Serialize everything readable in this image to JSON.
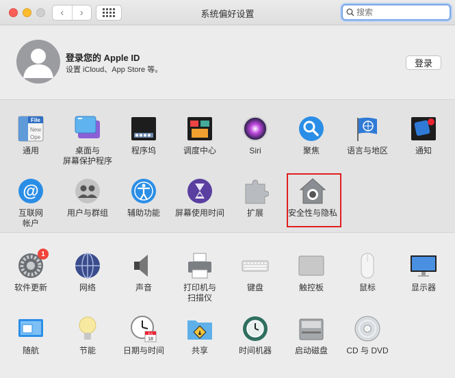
{
  "window": {
    "title": "系统偏好设置"
  },
  "search": {
    "placeholder": "搜索"
  },
  "account": {
    "title": "登录您的 Apple ID",
    "subtitle": "设置 iCloud、App Store 等。",
    "login_label": "登录"
  },
  "prefs_row1": [
    "通用",
    "桌面与\n屏幕保护程序",
    "程序坞",
    "调度中心",
    "Siri",
    "聚焦",
    "语言与地区",
    "通知"
  ],
  "prefs_row2": [
    "互联网\n帐户",
    "用户与群组",
    "辅助功能",
    "屏幕使用时间",
    "扩展",
    "安全性与隐私"
  ],
  "prefs_row3": [
    "软件更新",
    "网络",
    "声音",
    "打印机与\n扫描仪",
    "键盘",
    "触控板",
    "鼠标",
    "显示器"
  ],
  "prefs_row4": [
    "随航",
    "节能",
    "日期与时间",
    "共享",
    "时间机器",
    "启动磁盘",
    "CD 与 DVD"
  ],
  "software_update_badge": "1",
  "calendar_icon": {
    "month": "JUL",
    "day": "18"
  },
  "general_icon_text": [
    "File",
    "New",
    "Ope"
  ],
  "colors": {
    "highlight": "#e01e1e",
    "accent": "#3b82f6"
  }
}
